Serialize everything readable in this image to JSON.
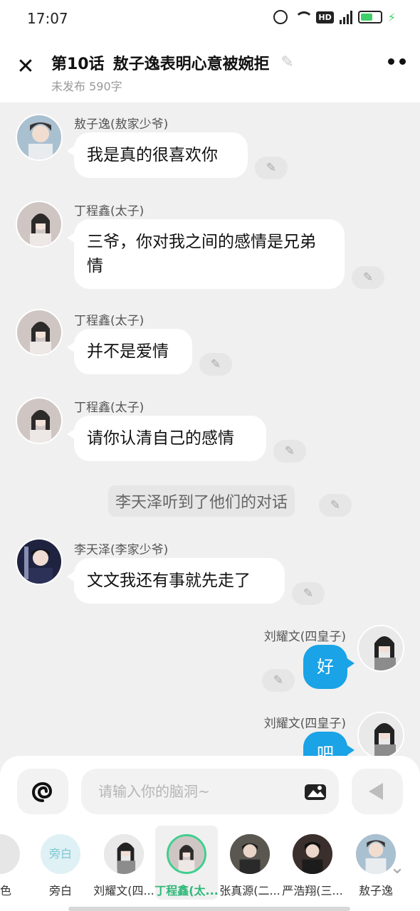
{
  "status": {
    "time": "17:07",
    "hd": "HD",
    "network": "4G"
  },
  "header": {
    "chapter": "第10话",
    "title": "敖子逸表明心意被婉拒",
    "subtitle": "未发布 590字"
  },
  "messages": [
    {
      "sender": "敖子逸(敖家少爷)",
      "text": "我是真的很喜欢你"
    },
    {
      "sender": "丁程鑫(太子)",
      "text": "三爷，你对我之间的感情是兄弟情"
    },
    {
      "sender": "丁程鑫(太子)",
      "text": "并不是爱情"
    },
    {
      "sender": "丁程鑫(太子)",
      "text": "请你认清自己的感情"
    },
    {
      "narration": "李天泽听到了他们的对话"
    },
    {
      "sender": "李天泽(李家少爷)",
      "text": "文文我还有事就先走了"
    },
    {
      "sender": "刘耀文(四皇子)",
      "text": "好"
    },
    {
      "sender": "刘耀文(四皇子)",
      "text": "吧"
    }
  ],
  "input": {
    "placeholder": "请输入你的脑洞~"
  },
  "roles": [
    {
      "name": "角色"
    },
    {
      "name": "旁白",
      "icon_text": "旁白"
    },
    {
      "name": "刘耀文(四..."
    },
    {
      "name": "丁程鑫(太..."
    },
    {
      "name": "张真源(二..."
    },
    {
      "name": "严浩翔(三..."
    },
    {
      "name": "敖子逸"
    }
  ],
  "colors": {
    "accent_blue": "#1aa3e6",
    "accent_green": "#2fb878"
  }
}
